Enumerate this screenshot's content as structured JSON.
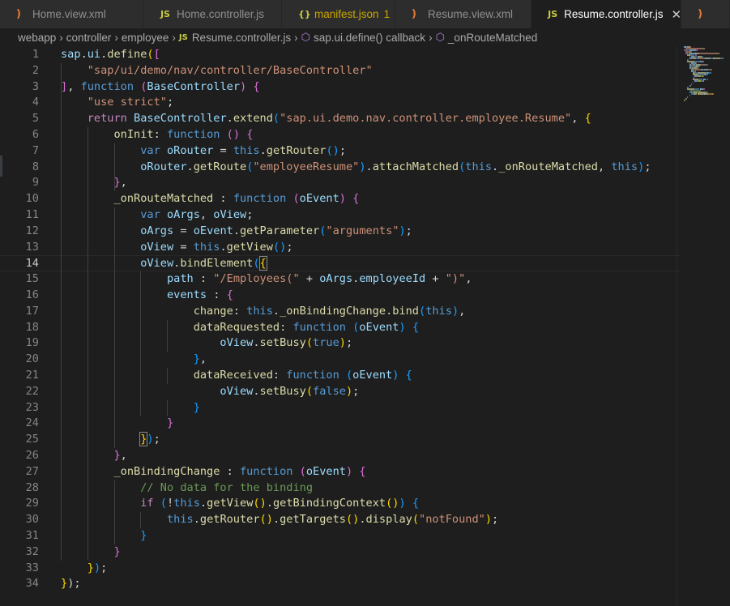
{
  "tabs": [
    {
      "icon": "rss-icon",
      "glyph": ")",
      "label": "Home.view.xml"
    },
    {
      "icon": "js-icon",
      "glyph": "JS",
      "label": "Home.controller.js"
    },
    {
      "icon": "json-icon",
      "glyph": "{}",
      "label": "manifest.json",
      "badge": "1"
    },
    {
      "icon": "rss-icon",
      "glyph": ")",
      "label": "Resume.view.xml"
    },
    {
      "icon": "js-icon",
      "glyph": "JS",
      "label": "Resume.controller.js",
      "close": "✕"
    }
  ],
  "breadcrumb": {
    "items": [
      "webapp",
      "controller",
      "employee"
    ],
    "file_icon": "JS",
    "file": "Resume.controller.js",
    "symbol1": "sap.ui.define() callback",
    "symbol2": "_onRouteMatched",
    "sep": "›"
  },
  "editor": {
    "current_line": 14,
    "lines": [
      {
        "n": "1"
      },
      {
        "n": "2"
      },
      {
        "n": "3"
      },
      {
        "n": "4"
      },
      {
        "n": "5"
      },
      {
        "n": "6"
      },
      {
        "n": "7"
      },
      {
        "n": "8"
      },
      {
        "n": "9"
      },
      {
        "n": "10"
      },
      {
        "n": "11"
      },
      {
        "n": "12"
      },
      {
        "n": "13"
      },
      {
        "n": "14"
      },
      {
        "n": "15"
      },
      {
        "n": "16"
      },
      {
        "n": "17"
      },
      {
        "n": "18"
      },
      {
        "n": "19"
      },
      {
        "n": "20"
      },
      {
        "n": "21"
      },
      {
        "n": "22"
      },
      {
        "n": "23"
      },
      {
        "n": "24"
      },
      {
        "n": "25"
      },
      {
        "n": "26"
      },
      {
        "n": "27"
      },
      {
        "n": "28"
      },
      {
        "n": "29"
      },
      {
        "n": "30"
      },
      {
        "n": "31"
      },
      {
        "n": "32"
      },
      {
        "n": "33"
      },
      {
        "n": "34"
      }
    ],
    "code": [
      [
        [
          "v",
          "sap"
        ],
        [
          "t",
          "."
        ],
        [
          "v",
          "ui"
        ],
        [
          "t",
          "."
        ],
        [
          "f",
          "define"
        ],
        [
          "b1",
          "("
        ],
        [
          "b2",
          "["
        ]
      ],
      [
        [
          "t",
          "    "
        ],
        [
          "s",
          "\"sap/ui/demo/nav/controller/BaseController\""
        ]
      ],
      [
        [
          "b2",
          "]"
        ],
        [
          "t",
          ", "
        ],
        [
          "k",
          "function"
        ],
        [
          "t",
          " "
        ],
        [
          "b2",
          "("
        ],
        [
          "v",
          "BaseController"
        ],
        [
          "b2",
          ")"
        ],
        [
          "t",
          " "
        ],
        [
          "b2",
          "{"
        ]
      ],
      [
        [
          "t",
          "    "
        ],
        [
          "s",
          "\"use strict\""
        ],
        [
          "t",
          ";"
        ]
      ],
      [
        [
          "t",
          "    "
        ],
        [
          "kc",
          "return"
        ],
        [
          "t",
          " "
        ],
        [
          "v",
          "BaseController"
        ],
        [
          "t",
          "."
        ],
        [
          "f",
          "extend"
        ],
        [
          "b3",
          "("
        ],
        [
          "s",
          "\"sap.ui.demo.nav.controller.employee.Resume\""
        ],
        [
          "t",
          ", "
        ],
        [
          "b1",
          "{"
        ]
      ],
      [
        [
          "t",
          "        "
        ],
        [
          "f",
          "onInit"
        ],
        [
          "t",
          ": "
        ],
        [
          "k",
          "function"
        ],
        [
          "t",
          " "
        ],
        [
          "b2",
          "()"
        ],
        [
          "t",
          " "
        ],
        [
          "b2",
          "{"
        ]
      ],
      [
        [
          "t",
          "            "
        ],
        [
          "k",
          "var"
        ],
        [
          "t",
          " "
        ],
        [
          "v",
          "oRouter"
        ],
        [
          "t",
          " = "
        ],
        [
          "k",
          "this"
        ],
        [
          "t",
          "."
        ],
        [
          "f",
          "getRouter"
        ],
        [
          "b3",
          "()"
        ],
        [
          "t",
          ";"
        ]
      ],
      [
        [
          "t",
          "            "
        ],
        [
          "v",
          "oRouter"
        ],
        [
          "t",
          "."
        ],
        [
          "f",
          "getRoute"
        ],
        [
          "b3",
          "("
        ],
        [
          "s",
          "\"employeeResume\""
        ],
        [
          "b3",
          ")"
        ],
        [
          "t",
          "."
        ],
        [
          "f",
          "attachMatched"
        ],
        [
          "b3",
          "("
        ],
        [
          "k",
          "this"
        ],
        [
          "t",
          "."
        ],
        [
          "f",
          "_onRouteMatched"
        ],
        [
          "t",
          ", "
        ],
        [
          "k",
          "this"
        ],
        [
          "b3",
          ")"
        ],
        [
          "t",
          ";"
        ]
      ],
      [
        [
          "t",
          "        "
        ],
        [
          "b2",
          "}"
        ],
        [
          "t",
          ","
        ]
      ],
      [
        [
          "t",
          "        "
        ],
        [
          "f",
          "_onRouteMatched"
        ],
        [
          "t",
          " : "
        ],
        [
          "k",
          "function"
        ],
        [
          "t",
          " "
        ],
        [
          "b2",
          "("
        ],
        [
          "v",
          "oEvent"
        ],
        [
          "b2",
          ")"
        ],
        [
          "t",
          " "
        ],
        [
          "b2",
          "{"
        ]
      ],
      [
        [
          "t",
          "            "
        ],
        [
          "k",
          "var"
        ],
        [
          "t",
          " "
        ],
        [
          "v",
          "oArgs"
        ],
        [
          "t",
          ", "
        ],
        [
          "v",
          "oView"
        ],
        [
          "t",
          ";"
        ]
      ],
      [
        [
          "t",
          "            "
        ],
        [
          "v",
          "oArgs"
        ],
        [
          "t",
          " = "
        ],
        [
          "v",
          "oEvent"
        ],
        [
          "t",
          "."
        ],
        [
          "f",
          "getParameter"
        ],
        [
          "b3",
          "("
        ],
        [
          "s",
          "\"arguments\""
        ],
        [
          "b3",
          ")"
        ],
        [
          "t",
          ";"
        ]
      ],
      [
        [
          "t",
          "            "
        ],
        [
          "v",
          "oView"
        ],
        [
          "t",
          " = "
        ],
        [
          "k",
          "this"
        ],
        [
          "t",
          "."
        ],
        [
          "f",
          "getView"
        ],
        [
          "b3",
          "()"
        ],
        [
          "t",
          ";"
        ]
      ],
      [
        [
          "t",
          "            "
        ],
        [
          "v",
          "oView"
        ],
        [
          "t",
          "."
        ],
        [
          "f",
          "bindElement"
        ],
        [
          "b3",
          "("
        ],
        [
          "b1m",
          "{"
        ]
      ],
      [
        [
          "t",
          "                "
        ],
        [
          "v",
          "path"
        ],
        [
          "t",
          " : "
        ],
        [
          "s",
          "\"/Employees(\""
        ],
        [
          "t",
          " + "
        ],
        [
          "v",
          "oArgs"
        ],
        [
          "t",
          "."
        ],
        [
          "v",
          "employeeId"
        ],
        [
          "t",
          " + "
        ],
        [
          "s",
          "\")\""
        ],
        [
          "t",
          ","
        ]
      ],
      [
        [
          "t",
          "                "
        ],
        [
          "v",
          "events"
        ],
        [
          "t",
          " : "
        ],
        [
          "b2",
          "{"
        ]
      ],
      [
        [
          "t",
          "                    "
        ],
        [
          "f",
          "change"
        ],
        [
          "t",
          ": "
        ],
        [
          "k",
          "this"
        ],
        [
          "t",
          "."
        ],
        [
          "f",
          "_onBindingChange"
        ],
        [
          "t",
          "."
        ],
        [
          "f",
          "bind"
        ],
        [
          "b3",
          "("
        ],
        [
          "k",
          "this"
        ],
        [
          "b3",
          ")"
        ],
        [
          "t",
          ","
        ]
      ],
      [
        [
          "t",
          "                    "
        ],
        [
          "f",
          "dataRequested"
        ],
        [
          "t",
          ": "
        ],
        [
          "k",
          "function"
        ],
        [
          "t",
          " "
        ],
        [
          "b3",
          "("
        ],
        [
          "v",
          "oEvent"
        ],
        [
          "b3",
          ")"
        ],
        [
          "t",
          " "
        ],
        [
          "b3",
          "{"
        ]
      ],
      [
        [
          "t",
          "                        "
        ],
        [
          "v",
          "oView"
        ],
        [
          "t",
          "."
        ],
        [
          "f",
          "setBusy"
        ],
        [
          "b1",
          "("
        ],
        [
          "k",
          "true"
        ],
        [
          "b1",
          ")"
        ],
        [
          "t",
          ";"
        ]
      ],
      [
        [
          "t",
          "                    "
        ],
        [
          "b3",
          "}"
        ],
        [
          "t",
          ","
        ]
      ],
      [
        [
          "t",
          "                    "
        ],
        [
          "f",
          "dataReceived"
        ],
        [
          "t",
          ": "
        ],
        [
          "k",
          "function"
        ],
        [
          "t",
          " "
        ],
        [
          "b3",
          "("
        ],
        [
          "v",
          "oEvent"
        ],
        [
          "b3",
          ")"
        ],
        [
          "t",
          " "
        ],
        [
          "b3",
          "{"
        ]
      ],
      [
        [
          "t",
          "                        "
        ],
        [
          "v",
          "oView"
        ],
        [
          "t",
          "."
        ],
        [
          "f",
          "setBusy"
        ],
        [
          "b1",
          "("
        ],
        [
          "k",
          "false"
        ],
        [
          "b1",
          ")"
        ],
        [
          "t",
          ";"
        ]
      ],
      [
        [
          "t",
          "                    "
        ],
        [
          "b3",
          "}"
        ]
      ],
      [
        [
          "t",
          "                "
        ],
        [
          "b2",
          "}"
        ]
      ],
      [
        [
          "t",
          "            "
        ],
        [
          "b1m",
          "}"
        ],
        [
          "b3",
          ")"
        ],
        [
          "t",
          ";"
        ]
      ],
      [
        [
          "t",
          "        "
        ],
        [
          "b2",
          "}"
        ],
        [
          "t",
          ","
        ]
      ],
      [
        [
          "t",
          "        "
        ],
        [
          "f",
          "_onBindingChange"
        ],
        [
          "t",
          " : "
        ],
        [
          "k",
          "function"
        ],
        [
          "t",
          " "
        ],
        [
          "b2",
          "("
        ],
        [
          "v",
          "oEvent"
        ],
        [
          "b2",
          ")"
        ],
        [
          "t",
          " "
        ],
        [
          "b2",
          "{"
        ]
      ],
      [
        [
          "t",
          "            "
        ],
        [
          "c",
          "// No data for the binding"
        ]
      ],
      [
        [
          "t",
          "            "
        ],
        [
          "kc",
          "if"
        ],
        [
          "t",
          " "
        ],
        [
          "b3",
          "("
        ],
        [
          "t",
          "!"
        ],
        [
          "k",
          "this"
        ],
        [
          "t",
          "."
        ],
        [
          "f",
          "getView"
        ],
        [
          "b1",
          "()"
        ],
        [
          "t",
          "."
        ],
        [
          "f",
          "getBindingContext"
        ],
        [
          "b1",
          "()"
        ],
        [
          "b3",
          ")"
        ],
        [
          "t",
          " "
        ],
        [
          "b3",
          "{"
        ]
      ],
      [
        [
          "t",
          "                "
        ],
        [
          "k",
          "this"
        ],
        [
          "t",
          "."
        ],
        [
          "f",
          "getRouter"
        ],
        [
          "b1",
          "()"
        ],
        [
          "t",
          "."
        ],
        [
          "f",
          "getTargets"
        ],
        [
          "b1",
          "()"
        ],
        [
          "t",
          "."
        ],
        [
          "f",
          "display"
        ],
        [
          "b1",
          "("
        ],
        [
          "s",
          "\"notFound\""
        ],
        [
          "b1",
          ")"
        ],
        [
          "t",
          ";"
        ]
      ],
      [
        [
          "t",
          "            "
        ],
        [
          "b3",
          "}"
        ]
      ],
      [
        [
          "t",
          "        "
        ],
        [
          "b2",
          "}"
        ]
      ],
      [
        [
          "t",
          "    "
        ],
        [
          "b1",
          "}"
        ],
        [
          "b3",
          ")"
        ],
        [
          "t",
          ";"
        ]
      ],
      [
        [
          "b1",
          "}"
        ],
        [
          "t",
          ");"
        ]
      ]
    ]
  }
}
